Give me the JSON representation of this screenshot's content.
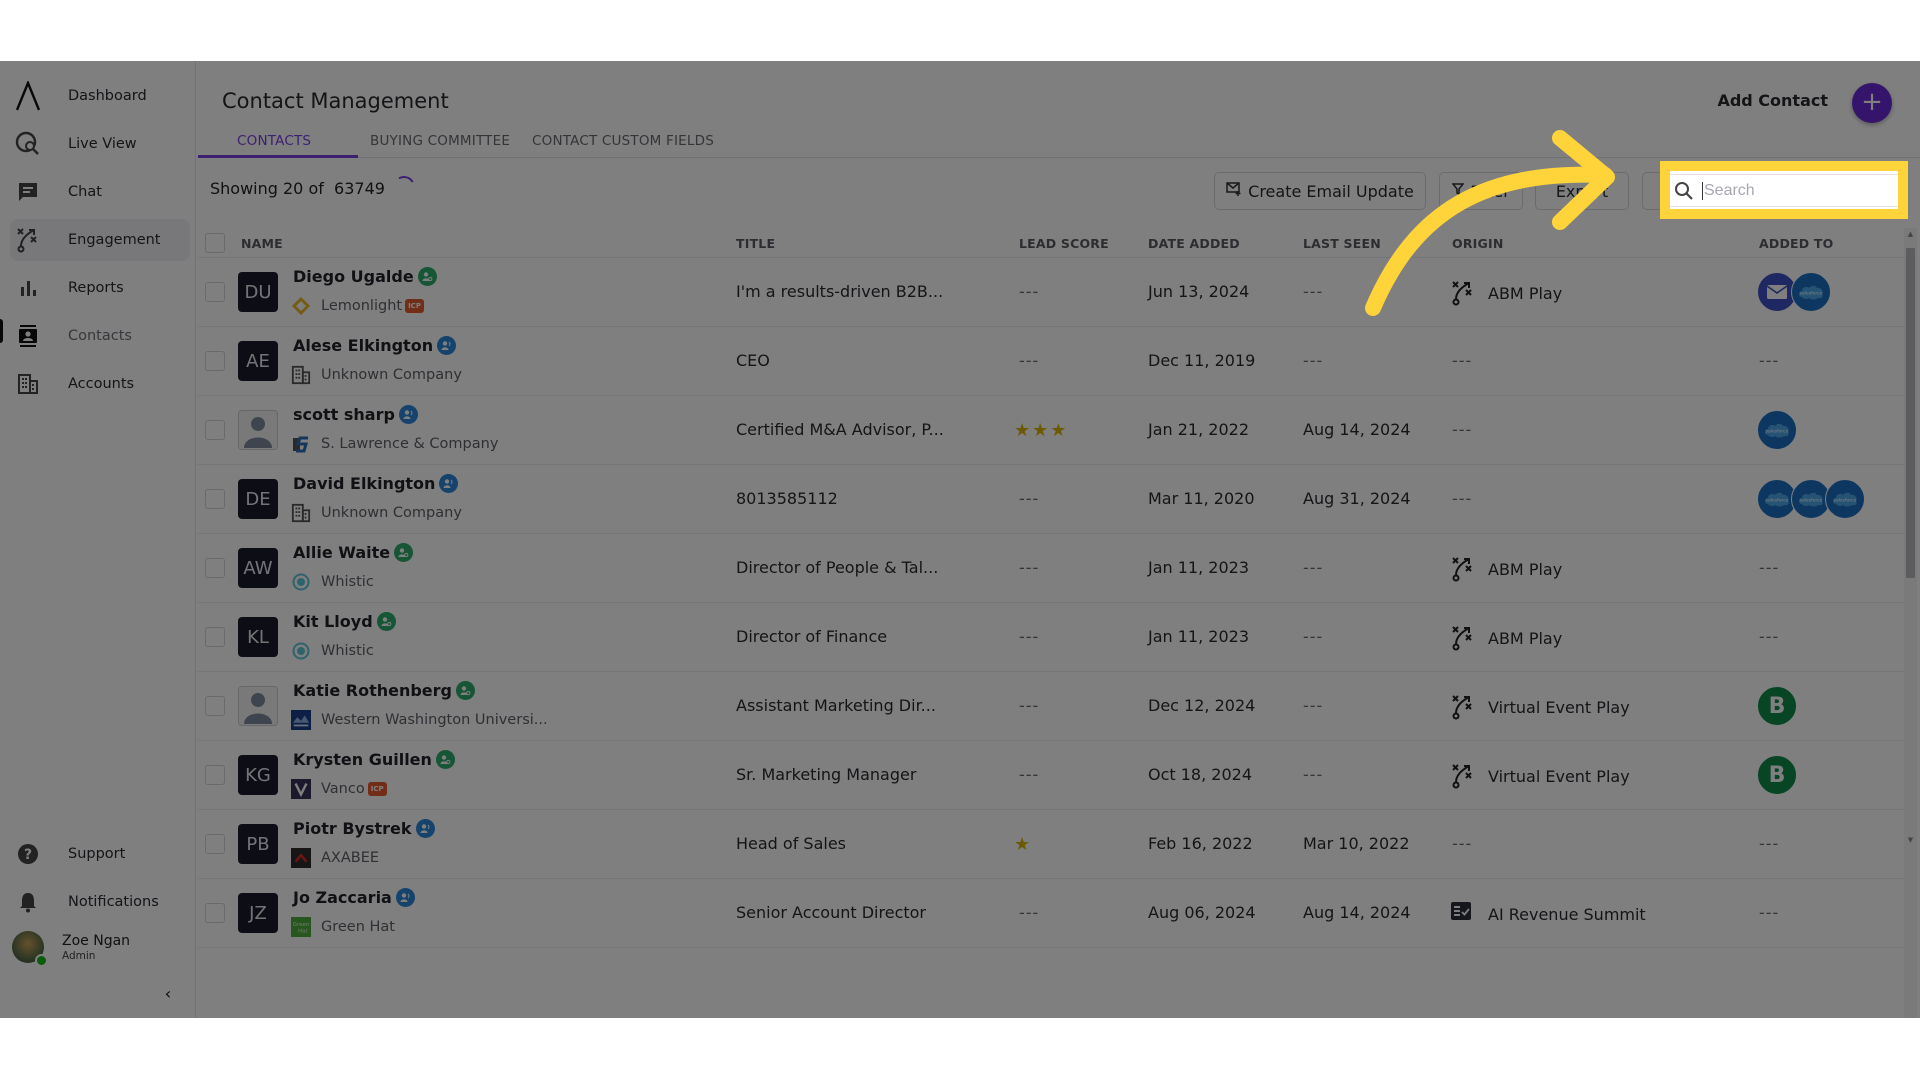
{
  "sidebar": {
    "items": [
      {
        "label": "Dashboard",
        "icon": "logo-icon"
      },
      {
        "label": "Live View",
        "icon": "live-view-icon"
      },
      {
        "label": "Chat",
        "icon": "chat-icon"
      },
      {
        "label": "Engagement",
        "icon": "engagement-icon"
      },
      {
        "label": "Reports",
        "icon": "bar-chart-icon"
      },
      {
        "label": "Contacts",
        "icon": "contacts-icon"
      },
      {
        "label": "Accounts",
        "icon": "building-icon"
      }
    ],
    "bottom": [
      {
        "label": "Support",
        "icon": "help-icon"
      },
      {
        "label": "Notifications",
        "icon": "bell-icon"
      }
    ],
    "user": {
      "name": "Zoe Ngan",
      "role": "Admin",
      "status_color": "#12b812"
    },
    "collapse_glyph": "‹"
  },
  "header": {
    "title": "Contact Management",
    "add_contact_label": "Add Contact",
    "add_glyph": "+"
  },
  "tabs": [
    {
      "label": "CONTACTS",
      "active": true
    },
    {
      "label": "BUYING COMMITTEE",
      "active": false
    },
    {
      "label": "CONTACT CUSTOM FIELDS",
      "active": false
    }
  ],
  "toolbar": {
    "showing_text": "Showing 20 of  63749",
    "create_email_update": "Create Email Update",
    "filter": "Filter",
    "export": "Export",
    "search_placeholder": "Search",
    "search_value": ""
  },
  "table": {
    "columns": [
      "NAME",
      "TITLE",
      "LEAD SCORE",
      "DATE ADDED",
      "LAST SEEN",
      "ORIGIN",
      "ADDED TO"
    ],
    "rows": [
      {
        "initials": "DU",
        "photo": false,
        "name": "Diego Ugalde",
        "badge": "green",
        "company": "Lemonlight",
        "company_logo": "lemonlight",
        "icp": true,
        "title": "I'm a results-driven B2B...",
        "lead_score": "---",
        "stars": 0,
        "date_added": "Jun 13, 2024",
        "last_seen": "---",
        "origin": "ABM Play",
        "origin_icon": "play-icon",
        "added_to": [
          "email",
          "salesforce"
        ]
      },
      {
        "initials": "AE",
        "photo": false,
        "name": "Alese Elkington",
        "badge": "blue",
        "company": "Unknown Company",
        "company_logo": "building",
        "icp": false,
        "title": "CEO",
        "lead_score": "---",
        "stars": 0,
        "date_added": "Dec 11, 2019",
        "last_seen": "---",
        "origin": "---",
        "origin_icon": "",
        "added_to": []
      },
      {
        "initials": "",
        "photo": true,
        "name": "scott sharp",
        "badge": "blue",
        "company": "S. Lawrence & Company",
        "company_logo": "slawrence",
        "icp": false,
        "title": "Certified M&A Advisor, P...",
        "lead_score": "",
        "stars": 3,
        "date_added": "Jan 21, 2022",
        "last_seen": "Aug 14, 2024",
        "origin": "---",
        "origin_icon": "",
        "added_to": [
          "salesforce"
        ]
      },
      {
        "initials": "DE",
        "photo": false,
        "name": "David Elkington",
        "badge": "blue",
        "company": "Unknown Company",
        "company_logo": "building",
        "icp": false,
        "title": "8013585112",
        "lead_score": "---",
        "stars": 0,
        "date_added": "Mar 11, 2020",
        "last_seen": "Aug 31, 2024",
        "origin": "---",
        "origin_icon": "",
        "added_to": [
          "salesforce",
          "salesforce",
          "salesforce"
        ]
      },
      {
        "initials": "AW",
        "photo": false,
        "name": "Allie Waite",
        "badge": "green",
        "company": "Whistic",
        "company_logo": "whistic",
        "icp": false,
        "title": "Director of People & Tal...",
        "lead_score": "---",
        "stars": 0,
        "date_added": "Jan 11, 2023",
        "last_seen": "---",
        "origin": "ABM Play",
        "origin_icon": "play-icon",
        "added_to": []
      },
      {
        "initials": "KL",
        "photo": false,
        "name": "Kit Lloyd",
        "badge": "green",
        "company": "Whistic",
        "company_logo": "whistic",
        "icp": false,
        "title": "Director of Finance",
        "lead_score": "---",
        "stars": 0,
        "date_added": "Jan 11, 2023",
        "last_seen": "---",
        "origin": "ABM Play",
        "origin_icon": "play-icon",
        "added_to": []
      },
      {
        "initials": "",
        "photo": true,
        "name": "Katie Rothenberg",
        "badge": "green",
        "company": "Western Washington Universi...",
        "company_logo": "wwu",
        "icp": false,
        "title": "Assistant Marketing Dir...",
        "lead_score": "---",
        "stars": 0,
        "date_added": "Dec 12, 2024",
        "last_seen": "---",
        "origin": "Virtual Event Play",
        "origin_icon": "play-icon",
        "added_to": [
          "b"
        ]
      },
      {
        "initials": "KG",
        "photo": false,
        "name": "Krysten Guillen",
        "badge": "green",
        "company": "Vanco",
        "company_logo": "vanco",
        "icp": true,
        "title": "Sr. Marketing Manager",
        "lead_score": "---",
        "stars": 0,
        "date_added": "Oct 18, 2024",
        "last_seen": "---",
        "origin": "Virtual Event Play",
        "origin_icon": "play-icon",
        "added_to": [
          "b"
        ]
      },
      {
        "initials": "PB",
        "photo": false,
        "name": "Piotr Bystrek",
        "badge": "blue",
        "company": "AXABEE",
        "company_logo": "axabee",
        "icp": false,
        "title": "Head of Sales",
        "lead_score": "",
        "stars": 1,
        "date_added": "Feb 16, 2022",
        "last_seen": "Mar 10, 2022",
        "origin": "---",
        "origin_icon": "",
        "added_to": []
      },
      {
        "initials": "JZ",
        "photo": false,
        "name": "Jo Zaccaria",
        "badge": "blue",
        "company": "Green Hat",
        "company_logo": "greenhat",
        "icp": false,
        "title": "Senior Account Director",
        "lead_score": "---",
        "stars": 0,
        "date_added": "Aug 06, 2024",
        "last_seen": "Aug 14, 2024",
        "origin": "AI Revenue Summit",
        "origin_icon": "event-icon",
        "added_to": []
      }
    ],
    "empty_value": "---",
    "icp_label": "ICP",
    "b_chip_label": "B",
    "salesforce_label": "salesforce"
  },
  "colors": {
    "accent": "#7b3fe4",
    "add_button": "#6a28d6",
    "highlight": "#ffd43b",
    "star": "#d9b400",
    "salesforce": "#1b6fc1",
    "badge_green": "#2daa6a",
    "badge_blue": "#2b86d8"
  }
}
